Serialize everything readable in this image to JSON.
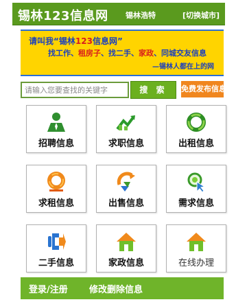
{
  "header": {
    "site_name": "锡林123信息网",
    "region": "锡林浩特",
    "switch_city": "[切换城市]"
  },
  "banner": {
    "line1_prefix": "请叫我“锡林",
    "line1_highlight": "123",
    "line1_suffix": "信息网”",
    "line2_a": "找工作、",
    "line2_b": "租房子",
    "line2_c": "、找二手、",
    "line2_d": "家政",
    "line2_e": "、同城交友信息",
    "line3": "—锡林人都在上的网"
  },
  "search": {
    "placeholder": "请输入您要查找的关键字",
    "button": "搜 索",
    "publish": "免费发布信息"
  },
  "categories": [
    {
      "label": "招聘信息",
      "icon": "recruit-person-icon"
    },
    {
      "label": "求职信息",
      "icon": "job-seeker-icon"
    },
    {
      "label": "出租信息",
      "icon": "green-ring-icon"
    },
    {
      "label": "求租信息",
      "icon": "orange-ring-icon"
    },
    {
      "label": "出售信息",
      "icon": "sale-arrow-icon"
    },
    {
      "label": "需求信息",
      "icon": "search-cursor-icon"
    },
    {
      "label": "二手信息",
      "icon": "recycle-hands-icon"
    },
    {
      "label": "家政信息",
      "icon": "house-icon"
    },
    {
      "label": "在线办理",
      "icon": "house-icon"
    }
  ],
  "footer": {
    "login": "登录/注册",
    "edit": "修改删除信息"
  },
  "colors": {
    "header_green": "#5a9a1e",
    "banner_yellow": "#ffd400",
    "banner_blue": "#1a3fbf",
    "highlight_red": "#d81d1d",
    "search_green": "#6bb01f",
    "publish_orange": "#f0861e",
    "footer_green": "#6fb42a"
  }
}
